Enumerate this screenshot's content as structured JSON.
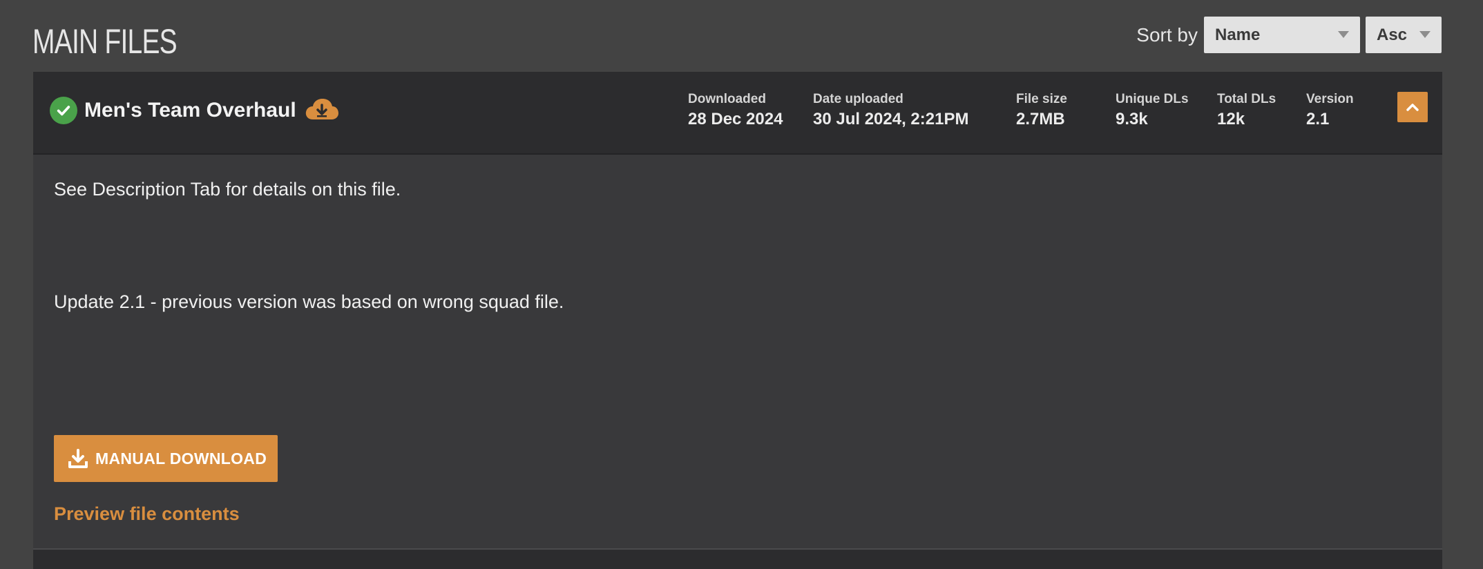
{
  "section": {
    "title": "MAIN FILES",
    "sort_label": "Sort by",
    "sort_field": "Name",
    "sort_direction": "Asc"
  },
  "file": {
    "name": "Men's Team Overhaul",
    "stats": {
      "downloaded_label": "Downloaded",
      "downloaded_value": "28 Dec 2024",
      "uploaded_label": "Date uploaded",
      "uploaded_value": "30 Jul 2024, 2:21PM",
      "size_label": "File size",
      "size_value": "2.7MB",
      "unique_label": "Unique DLs",
      "unique_value": "9.3k",
      "total_label": "Total DLs",
      "total_value": "12k",
      "version_label": "Version",
      "version_value": "2.1"
    },
    "description_line1": "See Description Tab for details on this file.",
    "description_line2": "Update 2.1 - previous version was based on wrong squad file.",
    "download_button": "MANUAL DOWNLOAD",
    "preview_link": "Preview file contents"
  },
  "icons": {
    "status": "check-circle-icon",
    "downloaded": "cloud-download-icon",
    "collapse": "chevron-up-icon",
    "download": "download-icon"
  },
  "colors": {
    "accent": "#d98e3f",
    "success": "#4aa24a",
    "background": "#434343",
    "card": "#39393b",
    "header": "#2c2c2e"
  }
}
